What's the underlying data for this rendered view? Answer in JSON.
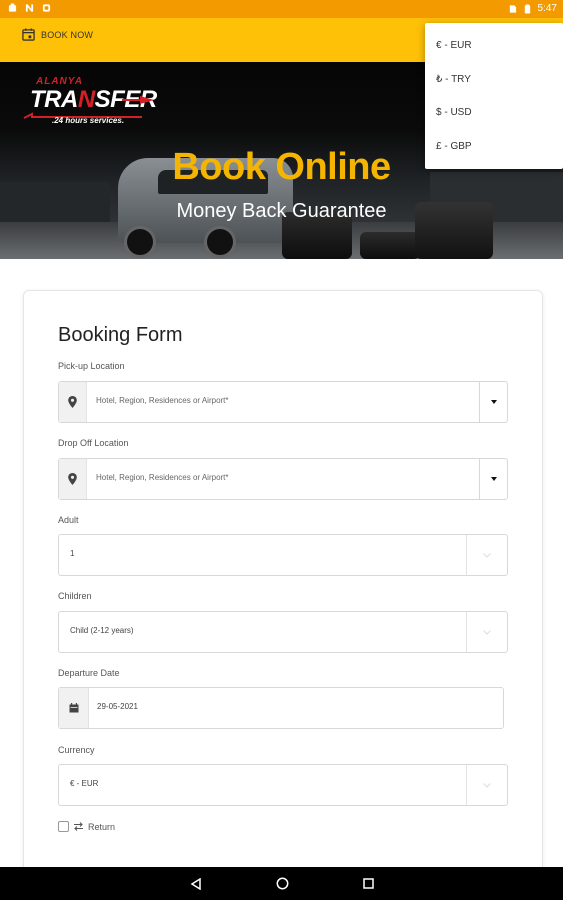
{
  "status_bar": {
    "time": "5:47"
  },
  "toolbar": {
    "book_now_label": "BOOK NOW"
  },
  "brand": {
    "logo_top": "ALANYA",
    "logo_main_a": "TRA",
    "logo_main_b": "N",
    "logo_main_c": "SFER",
    "logo_sub": ".24 hours services."
  },
  "hero": {
    "title": "Book Online",
    "subtitle": "Money Back Guarantee"
  },
  "currency_menu": {
    "options": [
      "€ - EUR",
      "₺ - TRY",
      "$ - USD",
      "£ - GBP"
    ]
  },
  "form": {
    "title": "Booking Form",
    "pickup": {
      "label": "Pick-up Location",
      "placeholder": "Hotel, Region, Residences or Airport*"
    },
    "dropoff": {
      "label": "Drop Off Location",
      "placeholder": "Hotel, Region, Residences or Airport*"
    },
    "adult": {
      "label": "Adult",
      "value": "1"
    },
    "children": {
      "label": "Children",
      "value": "Child (2-12 years)"
    },
    "departure": {
      "label": "Departure Date",
      "value": "29-05-2021"
    },
    "currency": {
      "label": "Currency",
      "value": "€ - EUR"
    },
    "return_label": "Return"
  },
  "colors": {
    "status_bar": "#f29a00",
    "toolbar": "#ffc107",
    "hero_title": "#f5b400",
    "logo_red": "#d32027"
  },
  "icons": [
    "calendar-icon",
    "map-marker-icon",
    "caret-down-icon",
    "exchange-icon",
    "back-icon",
    "home-icon",
    "recents-icon"
  ]
}
